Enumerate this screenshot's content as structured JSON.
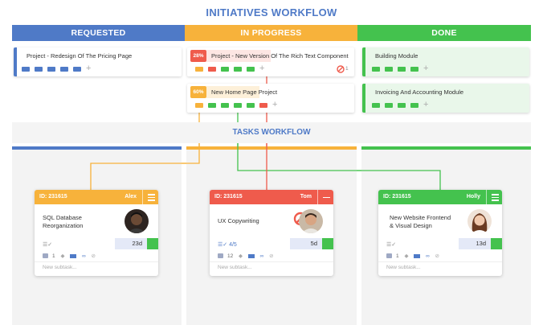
{
  "initiatives": {
    "title": "INITIATIVES WORKFLOW",
    "columns": [
      {
        "label": "REQUESTED",
        "color": "#4f7ac7"
      },
      {
        "label": "IN PROGRESS",
        "color": "#f7b23b"
      },
      {
        "label": "DONE",
        "color": "#44c24e"
      }
    ],
    "cards": [
      {
        "title": "Project - Redesign Of The Pricing Page"
      },
      {
        "title": "Project - New Version Of The Rich Text Component",
        "percent": "28%",
        "blocked_count": "1"
      },
      {
        "title": "New Home Page Project",
        "percent": "60%"
      },
      {
        "title": "Building Module"
      },
      {
        "title": "Invoicing And Accounting Module"
      }
    ]
  },
  "tasks": {
    "title": "TASKS WORKFLOW",
    "cards": [
      {
        "id": "ID: 231615",
        "assignee": "Alex",
        "title_line1": "SQL Database",
        "title_line2": "Reorganization",
        "days": "23d",
        "count": "1",
        "new_subtask": "New subtask..."
      },
      {
        "id": "ID: 231615",
        "assignee": "Tom",
        "title_line1": "UX Copywriting",
        "title_line2": "",
        "days": "5d",
        "checklist": "4/5",
        "count": "12",
        "new_subtask": "New subtask..."
      },
      {
        "id": "ID: 231615",
        "assignee": "Holly",
        "title_line1": "New Website Frontend",
        "title_line2": "& Visual Design",
        "days": "13d",
        "count": "1",
        "new_subtask": "New subtask..."
      }
    ]
  },
  "colors": {
    "blue": "#4f7ac7",
    "orange": "#f7b23b",
    "green": "#44c24e",
    "red": "#ef5b4c"
  }
}
